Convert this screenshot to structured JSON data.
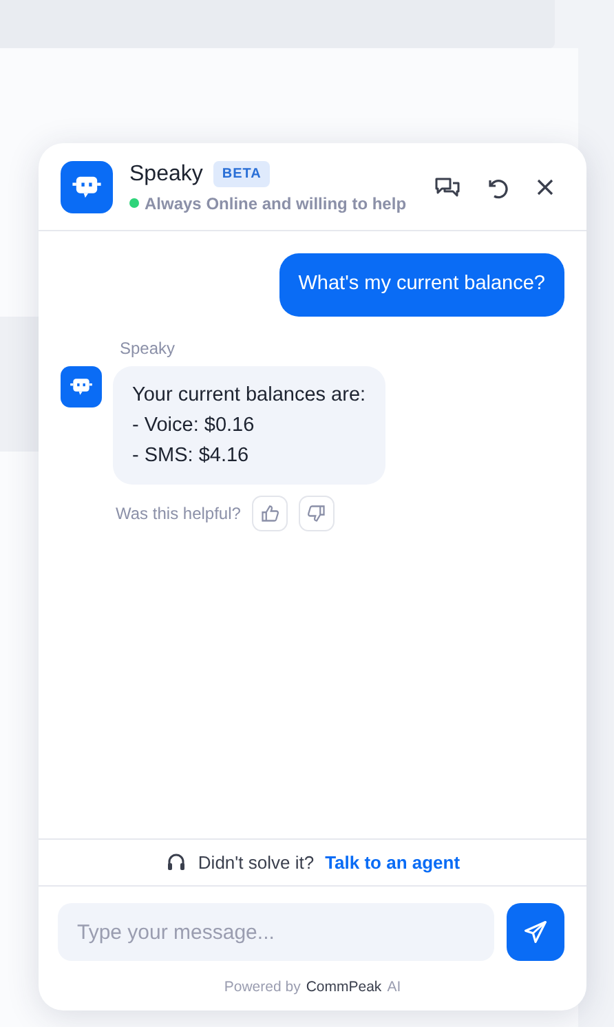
{
  "header": {
    "title": "Speaky",
    "badge": "BETA",
    "status": "Always Online and willing to help",
    "online": true
  },
  "messages": [
    {
      "kind": "user",
      "text": "What's my current balance?"
    },
    {
      "kind": "bot",
      "sender": "Speaky",
      "lines": [
        "Your current balances are:",
        "- Voice: $0.16",
        "- SMS: $4.16"
      ],
      "feedback_label": "Was this helpful?"
    }
  ],
  "agent_prompt": {
    "text": "Didn't solve it?",
    "link": "Talk to an agent"
  },
  "composer": {
    "placeholder": "Type your message..."
  },
  "footer": {
    "prefix": "Powered by",
    "brand": "CommPeak",
    "suffix": "AI"
  }
}
